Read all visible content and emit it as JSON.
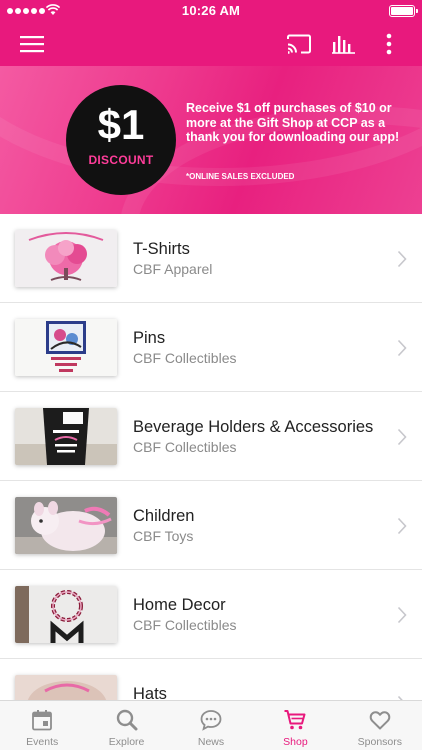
{
  "status_bar": {
    "time": "10:26 AM"
  },
  "toolbar": {
    "menu_icon": "hamburger-menu-icon",
    "cast_icon": "cast-icon",
    "chart_icon": "bar-chart-icon",
    "more_icon": "more-vertical-icon"
  },
  "promo": {
    "badge_amount": "$1",
    "badge_label": "DISCOUNT",
    "message": "Receive $1 off purchases of $10 or more at the Gift Shop at CCP as a thank you for downloading our app!",
    "note": "*ONLINE SALES EXCLUDED"
  },
  "categories": [
    {
      "title": "T-Shirts",
      "subtitle": "CBF Apparel"
    },
    {
      "title": "Pins",
      "subtitle": "CBF Collectibles"
    },
    {
      "title": "Beverage Holders & Accessories",
      "subtitle": "CBF Collectibles"
    },
    {
      "title": "Children",
      "subtitle": "CBF Toys"
    },
    {
      "title": "Home Decor",
      "subtitle": "CBF Collectibles"
    },
    {
      "title": "Hats",
      "subtitle": ""
    }
  ],
  "tabs": [
    {
      "label": "Events",
      "icon": "calendar-icon"
    },
    {
      "label": "Explore",
      "icon": "search-icon"
    },
    {
      "label": "News",
      "icon": "chat-bubble-icon"
    },
    {
      "label": "Shop",
      "icon": "shopping-cart-icon",
      "active": true
    },
    {
      "label": "Sponsors",
      "icon": "heart-icon"
    }
  ],
  "colors": {
    "brand": "#e8197d",
    "inactive": "#8e8e8e"
  }
}
